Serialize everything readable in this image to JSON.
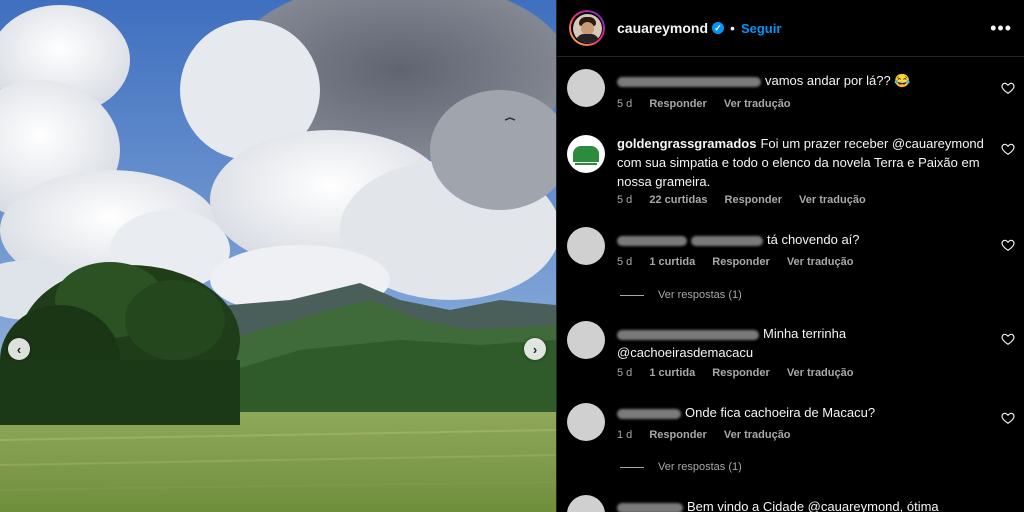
{
  "post": {
    "username": "cauareymond",
    "follow_label": "Seguir",
    "separator": "•",
    "more_label": "•••",
    "prev_label": "‹",
    "next_label": "›"
  },
  "comments": [
    {
      "user": "",
      "text": "vamos andar por lá?? 😂",
      "meta": [
        "5 d",
        "Responder",
        "Ver tradução"
      ],
      "avatar": "gray"
    },
    {
      "user": "goldengrassgramados",
      "text": "Foi um prazer receber @cauareymond com sua simpatia e todo o elenco da novela Terra e Paixão em nossa grameira.",
      "meta": [
        "5 d",
        "22 curtidas",
        "Responder",
        "Ver tradução"
      ],
      "avatar": "logo"
    },
    {
      "user": "",
      "text": "tá chovendo aí?",
      "meta": [
        "5 d",
        "1 curtida",
        "Responder",
        "Ver tradução"
      ],
      "replies": "Ver respostas (1)",
      "avatar": "gray"
    },
    {
      "user": "",
      "text": "Minha terrinha @cachoeirasdemacacu",
      "meta": [
        "5 d",
        "1 curtida",
        "Responder",
        "Ver tradução"
      ],
      "avatar": "gray"
    },
    {
      "user": "",
      "text": "Onde fica cachoeira de Macacu?",
      "meta": [
        "1 d",
        "Responder",
        "Ver tradução"
      ],
      "replies": "Ver respostas (1)",
      "avatar": "gray"
    },
    {
      "user": "",
      "text": "Bem vindo a Cidade @cauareymond, ótima",
      "avatar": "gray"
    }
  ]
}
